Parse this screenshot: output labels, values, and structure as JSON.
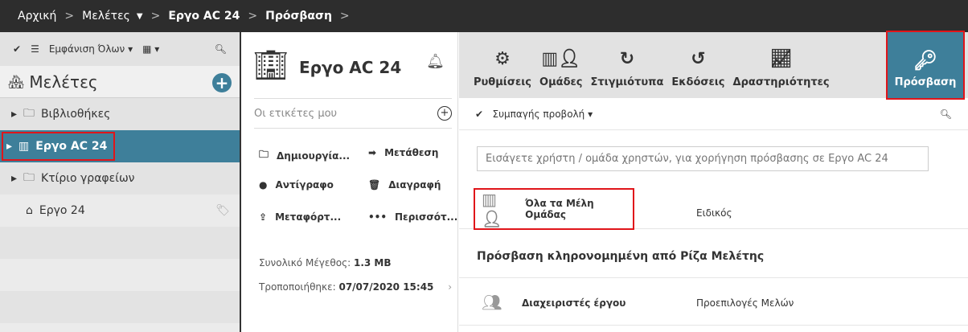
{
  "breadcrumb": [
    "Αρχική",
    "Μελέτες",
    "Εργο AC 24",
    "Πρόσβαση"
  ],
  "sidebar": {
    "filter": "Εμφάνιση Όλων",
    "title": "Μελέτες",
    "items": [
      {
        "label": "Βιβλιοθήκες"
      },
      {
        "label": "Εργο AC 24"
      },
      {
        "label": "Κτίριο γραφείων"
      },
      {
        "label": "Εργο 24"
      }
    ]
  },
  "detail": {
    "title": "Εργο AC 24",
    "tags_placeholder": "Οι ετικέτες μου",
    "actions": [
      "Δημιουργία...",
      "Μετάθεση",
      "Αντίγραφο",
      "Διαγραφή",
      "Μεταφόρτ...",
      "Περισσότ..."
    ],
    "size_label": "Συνολικό Μέγεθος:",
    "size": "1.3 MB",
    "modified_label": "Τροποποιήθηκε:",
    "modified": "07/07/2020 15:45"
  },
  "toolbar": {
    "tabs": [
      "Ρυθμίσεις",
      "Ομάδες",
      "Στιγμιότυπα",
      "Εκδόσεις",
      "Δραστηριότητες"
    ],
    "active": "Πρόσβαση"
  },
  "main": {
    "view": "Συμπαγής προβολή",
    "input_placeholder": "Εισάγετε χρήστη / ομάδα χρηστών, για χορήγηση πρόσβασης σε Εργο AC 24",
    "rows": [
      {
        "name": "Όλα τα Μέλη Ομάδας",
        "role": "Ειδικός"
      }
    ],
    "inherited_title": "Πρόσβαση κληρονομημένη από Ρίζα Μελέτης",
    "inherited": [
      {
        "name": "Διαχειριστές έργου",
        "role": "Προεπιλογές Μελών"
      }
    ]
  },
  "colors": {
    "accent": "#3e7f9a",
    "highlight": "#e0151a"
  }
}
